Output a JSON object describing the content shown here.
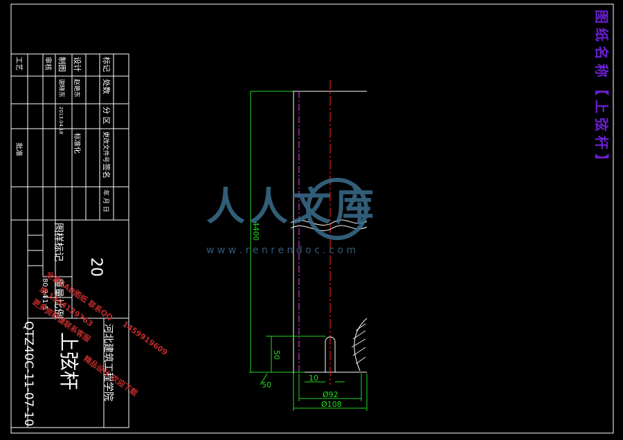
{
  "drawing": {
    "title_vertical": "图纸名称【上弦杆】",
    "colors": {
      "frame": "#ffffff",
      "title": "#6a1fd1",
      "dimension": "#22dd22",
      "centerline": "#ff2020",
      "hidden": "#ff33ff",
      "watermark": "#3a6e8c",
      "stamp": "#d03030"
    }
  },
  "title_block": {
    "rows": {
      "biaoji": "标记",
      "chushu": "处数",
      "fenqu": "分 区",
      "gengwenjian": "更改文件号",
      "qianming": "签名",
      "nianyueri": "年 月 日",
      "sheji": "设计",
      "sheji_name": "赵艳东",
      "biaozhunhua": "标准化",
      "zhitu": "制图",
      "zhitu_name": "谢晓东",
      "zhitu_date": "2013.04.18",
      "shenhe": "审核",
      "gongyi": "工艺",
      "pizhun": "批准"
    },
    "labels": {
      "jieduan": "图样标记",
      "zhongliang": "重量",
      "bili": "比例",
      "scale": "1:5",
      "weight": "80.94"
    },
    "sheet_number": "20",
    "company": "河北建筑工程学院",
    "part_name": "上弦杆",
    "drawing_number": "QTZ40C-11-07-10"
  },
  "dimensions": {
    "length": "4400",
    "slot_depth": "50",
    "weld": "50",
    "slot_width": "10",
    "inner_dia": "Ø92",
    "outer_dia": "Ø108"
  },
  "watermark": {
    "logo_text": "人人文库",
    "url": "w w w . r e n r e n d o c . c o m"
  },
  "stamp": {
    "line1": "全套CAD图纸 联系QQ",
    "line2": "1459919609",
    "line3": "或 1304139763",
    "line4": "更多资料请联系客服",
    "line5": "精品设计 欢迎下载"
  }
}
